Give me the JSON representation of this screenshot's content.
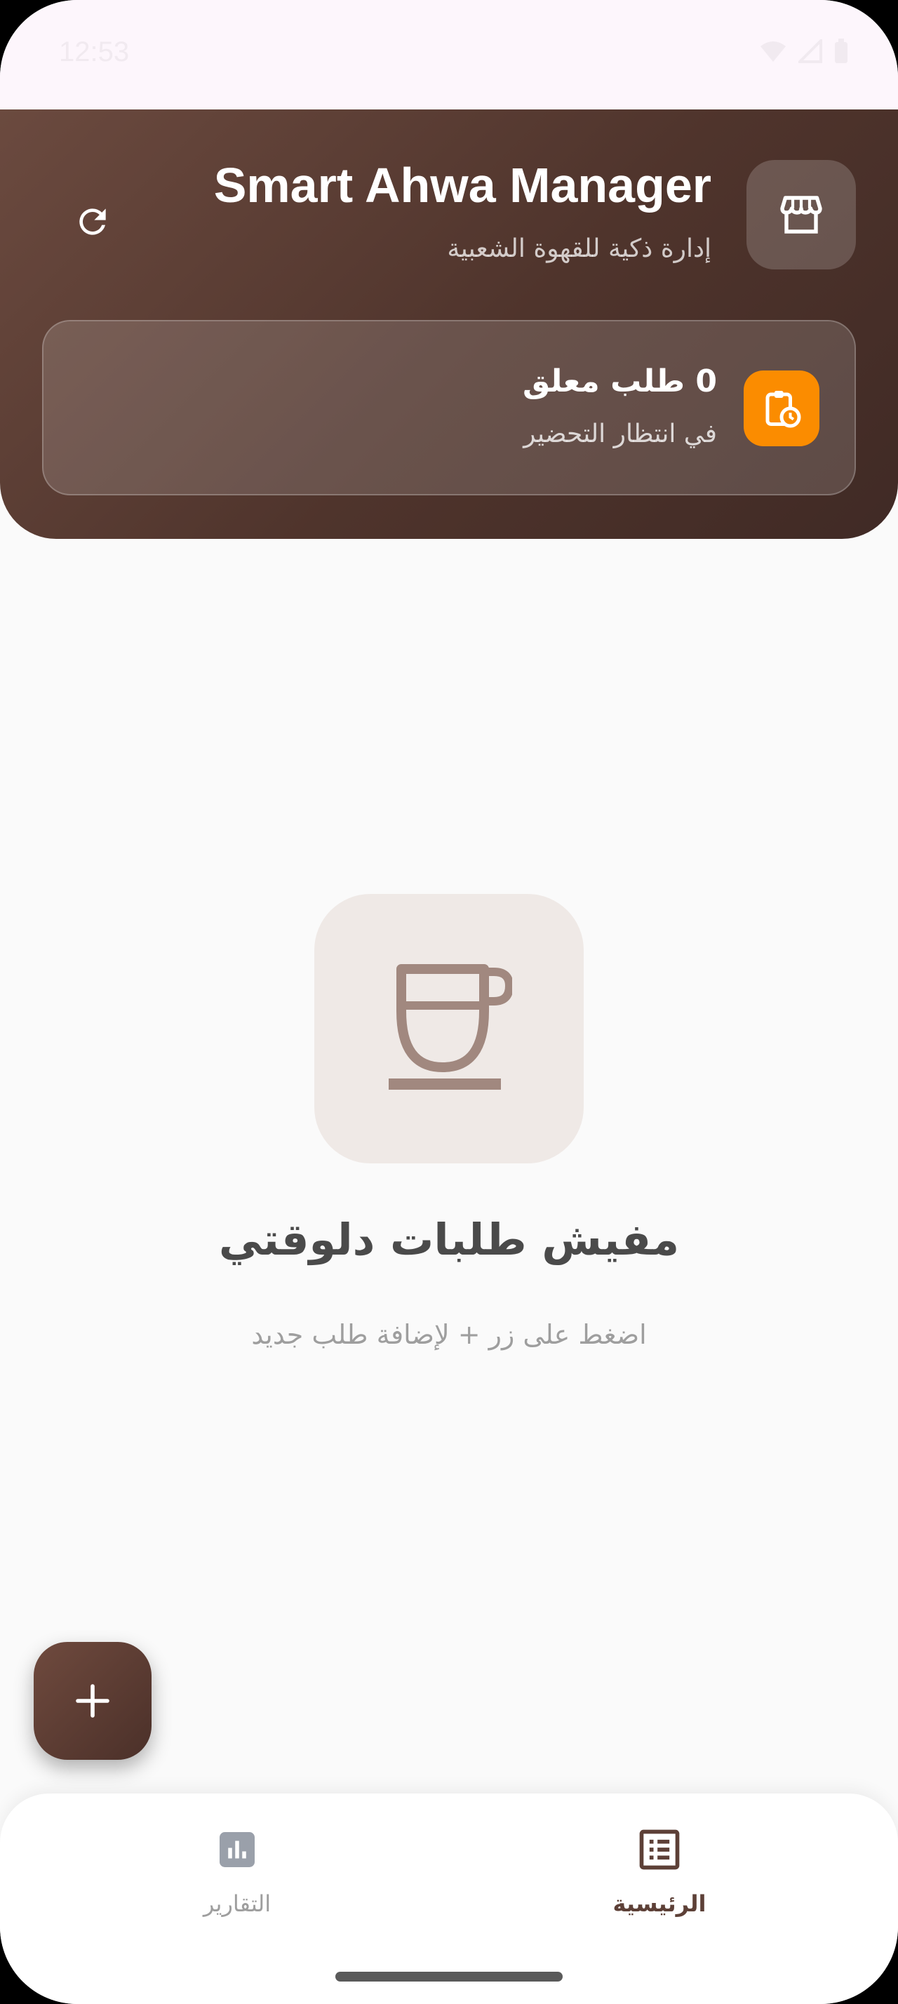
{
  "status_bar": {
    "time": "12:53"
  },
  "header": {
    "title": "Smart Ahwa Manager",
    "subtitle": "إدارة ذكية للقهوة الشعبية",
    "store_icon": "store-icon",
    "refresh_icon": "refresh-icon"
  },
  "pending": {
    "count_text": "0 طلب معلق",
    "label": "في انتظار التحضير",
    "icon": "pending-clipboard-icon",
    "accent_color": "#fb8c00"
  },
  "empty_state": {
    "icon": "coffee-cup-icon",
    "title": "مفيش طلبات دلوقتي",
    "subtitle": "اضغط على زر + لإضافة طلب جديد"
  },
  "fab": {
    "icon": "add-icon"
  },
  "bottom_nav": {
    "items": [
      {
        "label": "الرئيسية",
        "icon": "home-list-icon",
        "active": true
      },
      {
        "label": "التقارير",
        "icon": "reports-chart-icon",
        "active": false
      }
    ]
  },
  "colors": {
    "header_brown": "#4f342c",
    "primary_brown": "#5d4037",
    "orange": "#fb8c00"
  }
}
